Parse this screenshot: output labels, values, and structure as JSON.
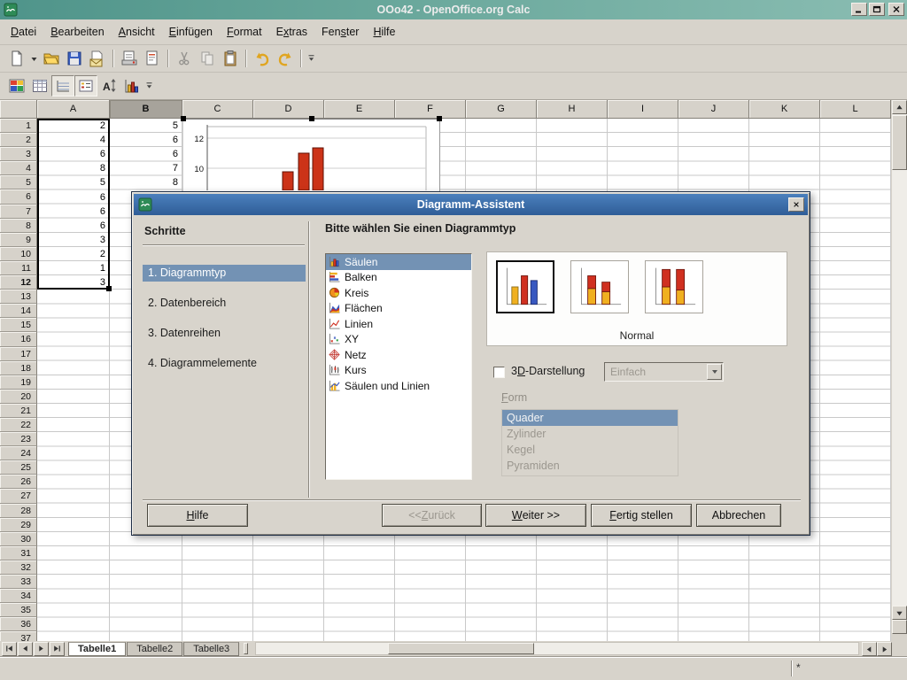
{
  "window": {
    "title": "OOo42 - OpenOffice.org Calc",
    "controls": [
      {
        "name": "minimize-button",
        "icon": "win-min"
      },
      {
        "name": "maximize-button",
        "icon": "win-max"
      },
      {
        "name": "close-button",
        "icon": "win-close"
      }
    ]
  },
  "colors": {
    "titlebar_teal": "#5d9f94",
    "dialog_titlebar_blue": "#3d6fae",
    "selection_blue": "#7392b4",
    "chart_bar_red": "#cc3318"
  },
  "menubar": {
    "items": [
      {
        "label": "Datei",
        "key": "D"
      },
      {
        "label": "Bearbeiten",
        "key": "B"
      },
      {
        "label": "Ansicht",
        "key": "A"
      },
      {
        "label": "Einfügen",
        "key": "E"
      },
      {
        "label": "Format",
        "key": "F"
      },
      {
        "label": "Extras",
        "key": "x"
      },
      {
        "label": "Fenster",
        "key": "s"
      },
      {
        "label": "Hilfe",
        "key": "H"
      }
    ]
  },
  "toolbar_main": {
    "items": [
      {
        "icon": "newdoc",
        "name": "new-document-button"
      },
      {
        "icon": "caret",
        "name": "new-document-dropdown"
      },
      {
        "icon": "open",
        "name": "open-button"
      },
      {
        "icon": "save",
        "name": "save-button"
      },
      {
        "icon": "email",
        "name": "email-document-button"
      },
      {
        "sep": true
      },
      {
        "icon": "printdirect",
        "name": "print-direct-button"
      },
      {
        "icon": "pagepreview",
        "name": "page-preview-button"
      },
      {
        "sep": true
      },
      {
        "icon": "cut",
        "name": "cut-button",
        "disabled": true
      },
      {
        "icon": "copy",
        "name": "copy-button",
        "disabled": true
      },
      {
        "icon": "paste",
        "name": "paste-button"
      },
      {
        "sep": true
      },
      {
        "icon": "undo",
        "name": "undo-button"
      },
      {
        "icon": "redo",
        "name": "redo-button"
      },
      {
        "sep": true
      },
      {
        "icon": "overflow",
        "name": "toolbar-options-button"
      }
    ]
  },
  "toolbar_chart": {
    "items": [
      {
        "icon": "chartformat",
        "name": "format-selection-button"
      },
      {
        "icon": "datatable",
        "name": "chart-data-table-button"
      },
      {
        "icon": "gridtoggle",
        "name": "horizontal-grids-button",
        "pressed": true
      },
      {
        "icon": "legendtoggle",
        "name": "legend-on-off-button",
        "pressed": true
      },
      {
        "icon": "scaletext",
        "name": "scale-text-button"
      },
      {
        "icon": "chartbars",
        "name": "chart-type-button"
      },
      {
        "icon": "overflow",
        "name": "toolbar-options-button"
      }
    ]
  },
  "grid": {
    "columns": [
      "A",
      "B",
      "C",
      "D",
      "E",
      "F",
      "G",
      "H",
      "I",
      "J",
      "K",
      "L"
    ],
    "selected_column": "B",
    "row_count": 37,
    "active_row": 12,
    "selected_range": "A1:A12",
    "cells": {
      "A": [
        "2",
        "4",
        "6",
        "8",
        "5",
        "6",
        "6",
        "6",
        "3",
        "2",
        "1",
        "3"
      ],
      "B": [
        "5",
        "6",
        "6",
        "7",
        "8"
      ]
    }
  },
  "chart_preview": {
    "y_axis_labels": [
      "12",
      "10"
    ]
  },
  "sheet_tabs": {
    "labels": [
      "Tabelle1",
      "Tabelle2",
      "Tabelle3"
    ],
    "active_index": 0,
    "nav": [
      {
        "name": "first-sheet-button",
        "icon": "nav-first"
      },
      {
        "name": "previous-sheet-button",
        "icon": "nav-prev"
      },
      {
        "name": "next-sheet-button",
        "icon": "nav-next"
      },
      {
        "name": "last-sheet-button",
        "icon": "nav-last"
      }
    ]
  },
  "status_bar": {
    "modified_indicator": "*"
  },
  "dialog": {
    "title": "Diagramm-Assistent",
    "steps_heading": "Schritte",
    "steps": [
      "1. Diagrammtyp",
      "2. Datenbereich",
      "3. Datenreihen",
      "4. Diagrammelemente"
    ],
    "selected_step": 0,
    "choose_heading": "Bitte wählen Sie einen Diagrammtyp",
    "chart_types": [
      {
        "label": "Säulen",
        "icon": "ct-columns-icon"
      },
      {
        "label": "Balken",
        "icon": "ct-bars-icon"
      },
      {
        "label": "Kreis",
        "icon": "ct-pie-icon"
      },
      {
        "label": "Flächen",
        "icon": "ct-areas-icon"
      },
      {
        "label": "Linien",
        "icon": "ct-lines-icon"
      },
      {
        "label": "XY",
        "icon": "ct-xy-icon"
      },
      {
        "label": "Netz",
        "icon": "ct-net-icon"
      },
      {
        "label": "Kurs",
        "icon": "ct-stock-icon"
      },
      {
        "label": "Säulen und Linien",
        "icon": "ct-colline-icon"
      }
    ],
    "selected_type_index": 0,
    "subtypes": [
      {
        "name": "subtype-normal",
        "icon": "thumb-normal",
        "selected": true
      },
      {
        "name": "subtype-stacked",
        "icon": "thumb-stacked"
      },
      {
        "name": "subtype-percent",
        "icon": "thumb-percent"
      }
    ],
    "subtype_caption": "Normal",
    "threed": {
      "label": "3D-Darstellung",
      "key": "D",
      "checked": false,
      "dropdown_value": "Einfach",
      "disabled": true
    },
    "form": {
      "label": "Form",
      "key": "F",
      "options": [
        "Quader",
        "Zylinder",
        "Kegel",
        "Pyramiden"
      ],
      "selected": "Quader",
      "disabled": true
    },
    "buttons": [
      {
        "label": "Hilfe",
        "key": "H",
        "name": "help-button"
      },
      {
        "label": "<< Zurück",
        "key": "Z",
        "name": "back-button",
        "disabled": true
      },
      {
        "label": "Weiter >>",
        "key": "W",
        "name": "next-button"
      },
      {
        "label": "Fertig stellen",
        "key": "F",
        "name": "finish-button"
      },
      {
        "label": "Abbrechen",
        "name": "cancel-button"
      }
    ]
  }
}
